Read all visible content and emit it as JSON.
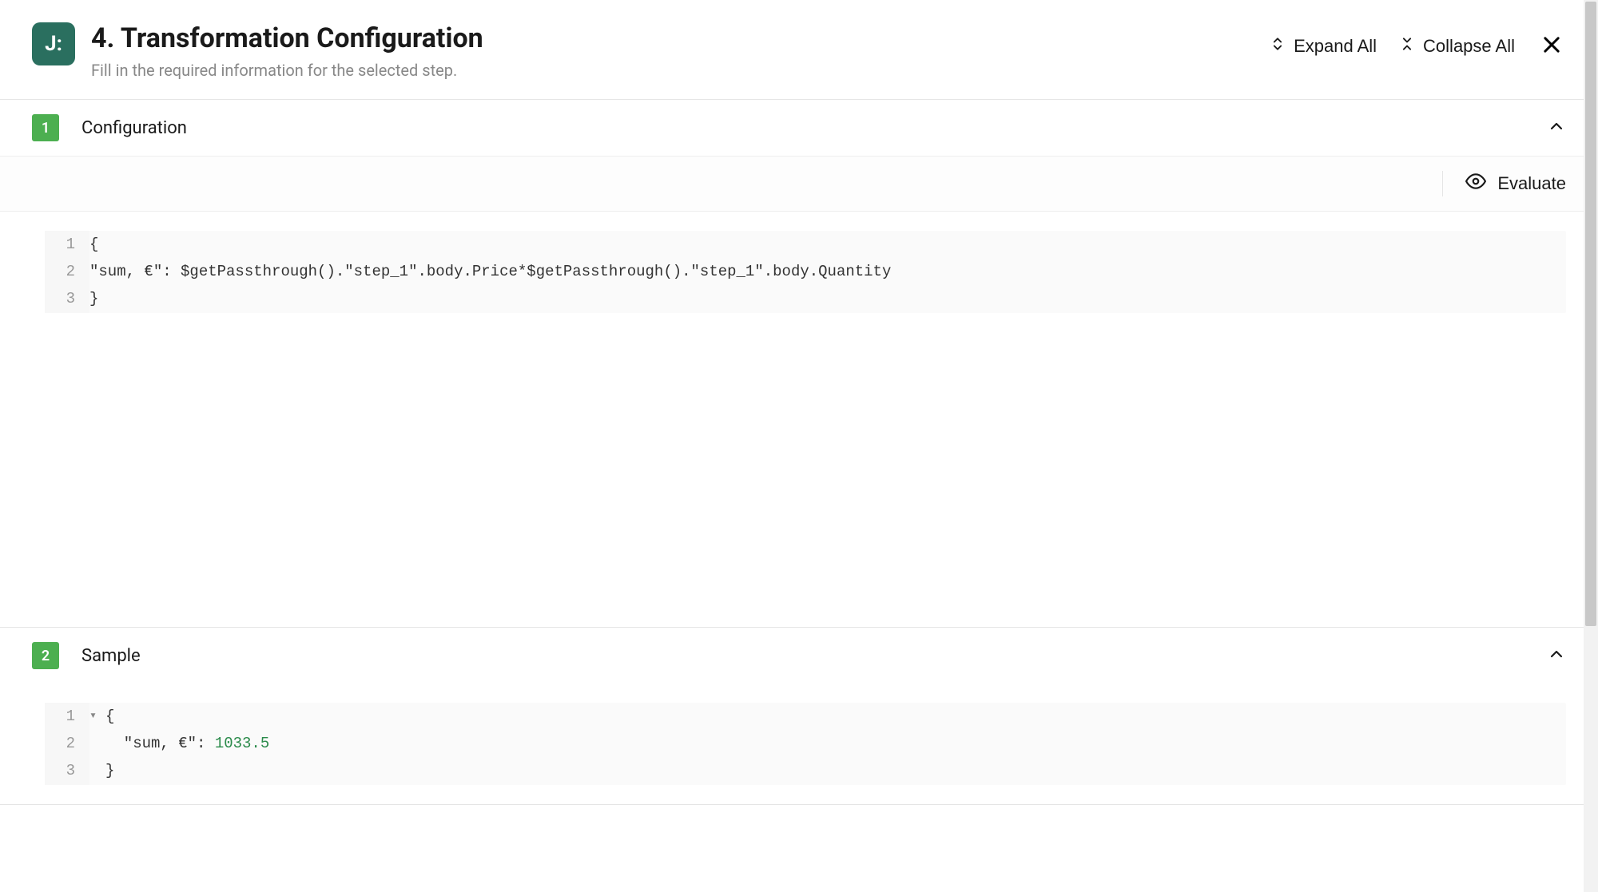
{
  "header": {
    "logo_text": "J:",
    "title": "4. Transformation Configuration",
    "subtitle": "Fill in the required information for the selected step.",
    "expand_all_label": "Expand All",
    "collapse_all_label": "Collapse All"
  },
  "sections": [
    {
      "badge": "1",
      "title": "Configuration",
      "evaluate_label": "Evaluate",
      "code_lines": [
        {
          "num": "1",
          "content": "{"
        },
        {
          "num": "2",
          "content": "\"sum, €\": $getPassthrough().\"step_1\".body.Price*$getPassthrough().\"step_1\".body.Quantity"
        },
        {
          "num": "3",
          "content": "}"
        }
      ]
    },
    {
      "badge": "2",
      "title": "Sample",
      "code_lines": [
        {
          "num": "1",
          "fold": "▾",
          "content": "{"
        },
        {
          "num": "2",
          "content_key": "  \"sum, €\": ",
          "content_value": "1033.5"
        },
        {
          "num": "3",
          "content": "}"
        }
      ]
    }
  ]
}
